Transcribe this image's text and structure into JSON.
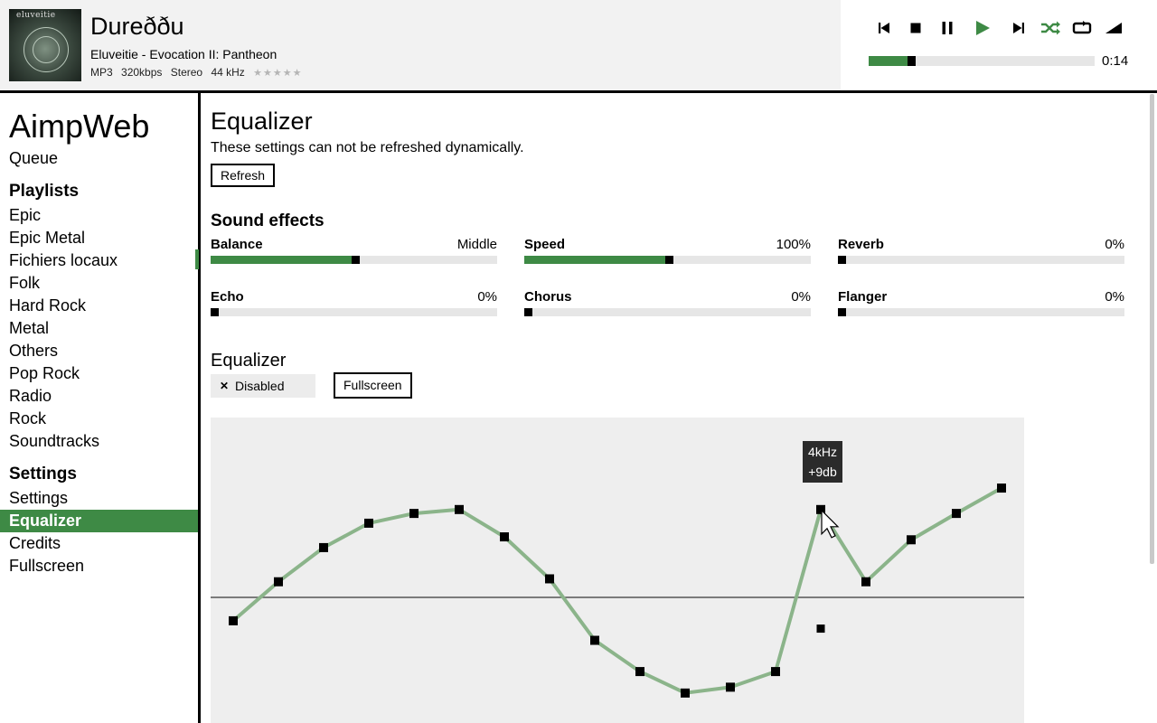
{
  "header": {
    "album_art_text": "eluveitie",
    "title": "Dureððu",
    "artist_album": "Eluveitie - Evocation II: Pantheon",
    "meta": {
      "format": "MP3",
      "bitrate": "320kbps",
      "channels": "Stereo",
      "sample_rate": "44 kHz"
    },
    "rating": "★★★★★",
    "time": "0:14",
    "progress_fraction": 0.17,
    "controls": [
      "previous-icon",
      "stop-icon",
      "pause-icon",
      "play-icon",
      "next-icon",
      "shuffle-icon",
      "repeat-icon",
      "volume-icon"
    ]
  },
  "sidebar": {
    "app_title": "AimpWeb",
    "queue": "Queue",
    "playlists_heading": "Playlists",
    "playlists": [
      "Epic",
      "Epic Metal",
      "Fichiers locaux",
      "Folk",
      "Hard Rock",
      "Metal",
      "Others",
      "Pop Rock",
      "Radio",
      "Rock",
      "Soundtracks"
    ],
    "settings_heading": "Settings",
    "settings_items": [
      "Settings",
      "Equalizer",
      "Credits",
      "Fullscreen"
    ],
    "active_item": "Equalizer"
  },
  "main": {
    "title": "Equalizer",
    "note": "These settings can not be refreshed dynamically.",
    "refresh_label": "Refresh",
    "sound_effects_heading": "Sound effects",
    "effects": [
      {
        "label": "Balance",
        "value": "Middle",
        "level": 0.5
      },
      {
        "label": "Speed",
        "value": "100%",
        "level": 0.5
      },
      {
        "label": "Reverb",
        "value": "0%",
        "level": 0
      },
      {
        "label": "Echo",
        "value": "0%",
        "level": 0
      },
      {
        "label": "Chorus",
        "value": "0%",
        "level": 0
      },
      {
        "label": "Flanger",
        "value": "0%",
        "level": 0
      }
    ],
    "equalizer_heading": "Equalizer",
    "toggle_label": "Disabled",
    "fullscreen_label": "Fullscreen",
    "bands_db": [
      -2.4,
      1.6,
      5.1,
      7.6,
      8.6,
      9.0,
      6.2,
      1.9,
      -4.4,
      -7.6,
      -9.8,
      -9.2,
      -7.6,
      9.0,
      1.6,
      5.9,
      8.6,
      11.2
    ],
    "previous_band_db": -3.2,
    "tooltip": {
      "band": "4kHz",
      "value": "+9db"
    }
  },
  "colors": {
    "accent": "#3e8a45",
    "curve": "#8bb48a"
  }
}
